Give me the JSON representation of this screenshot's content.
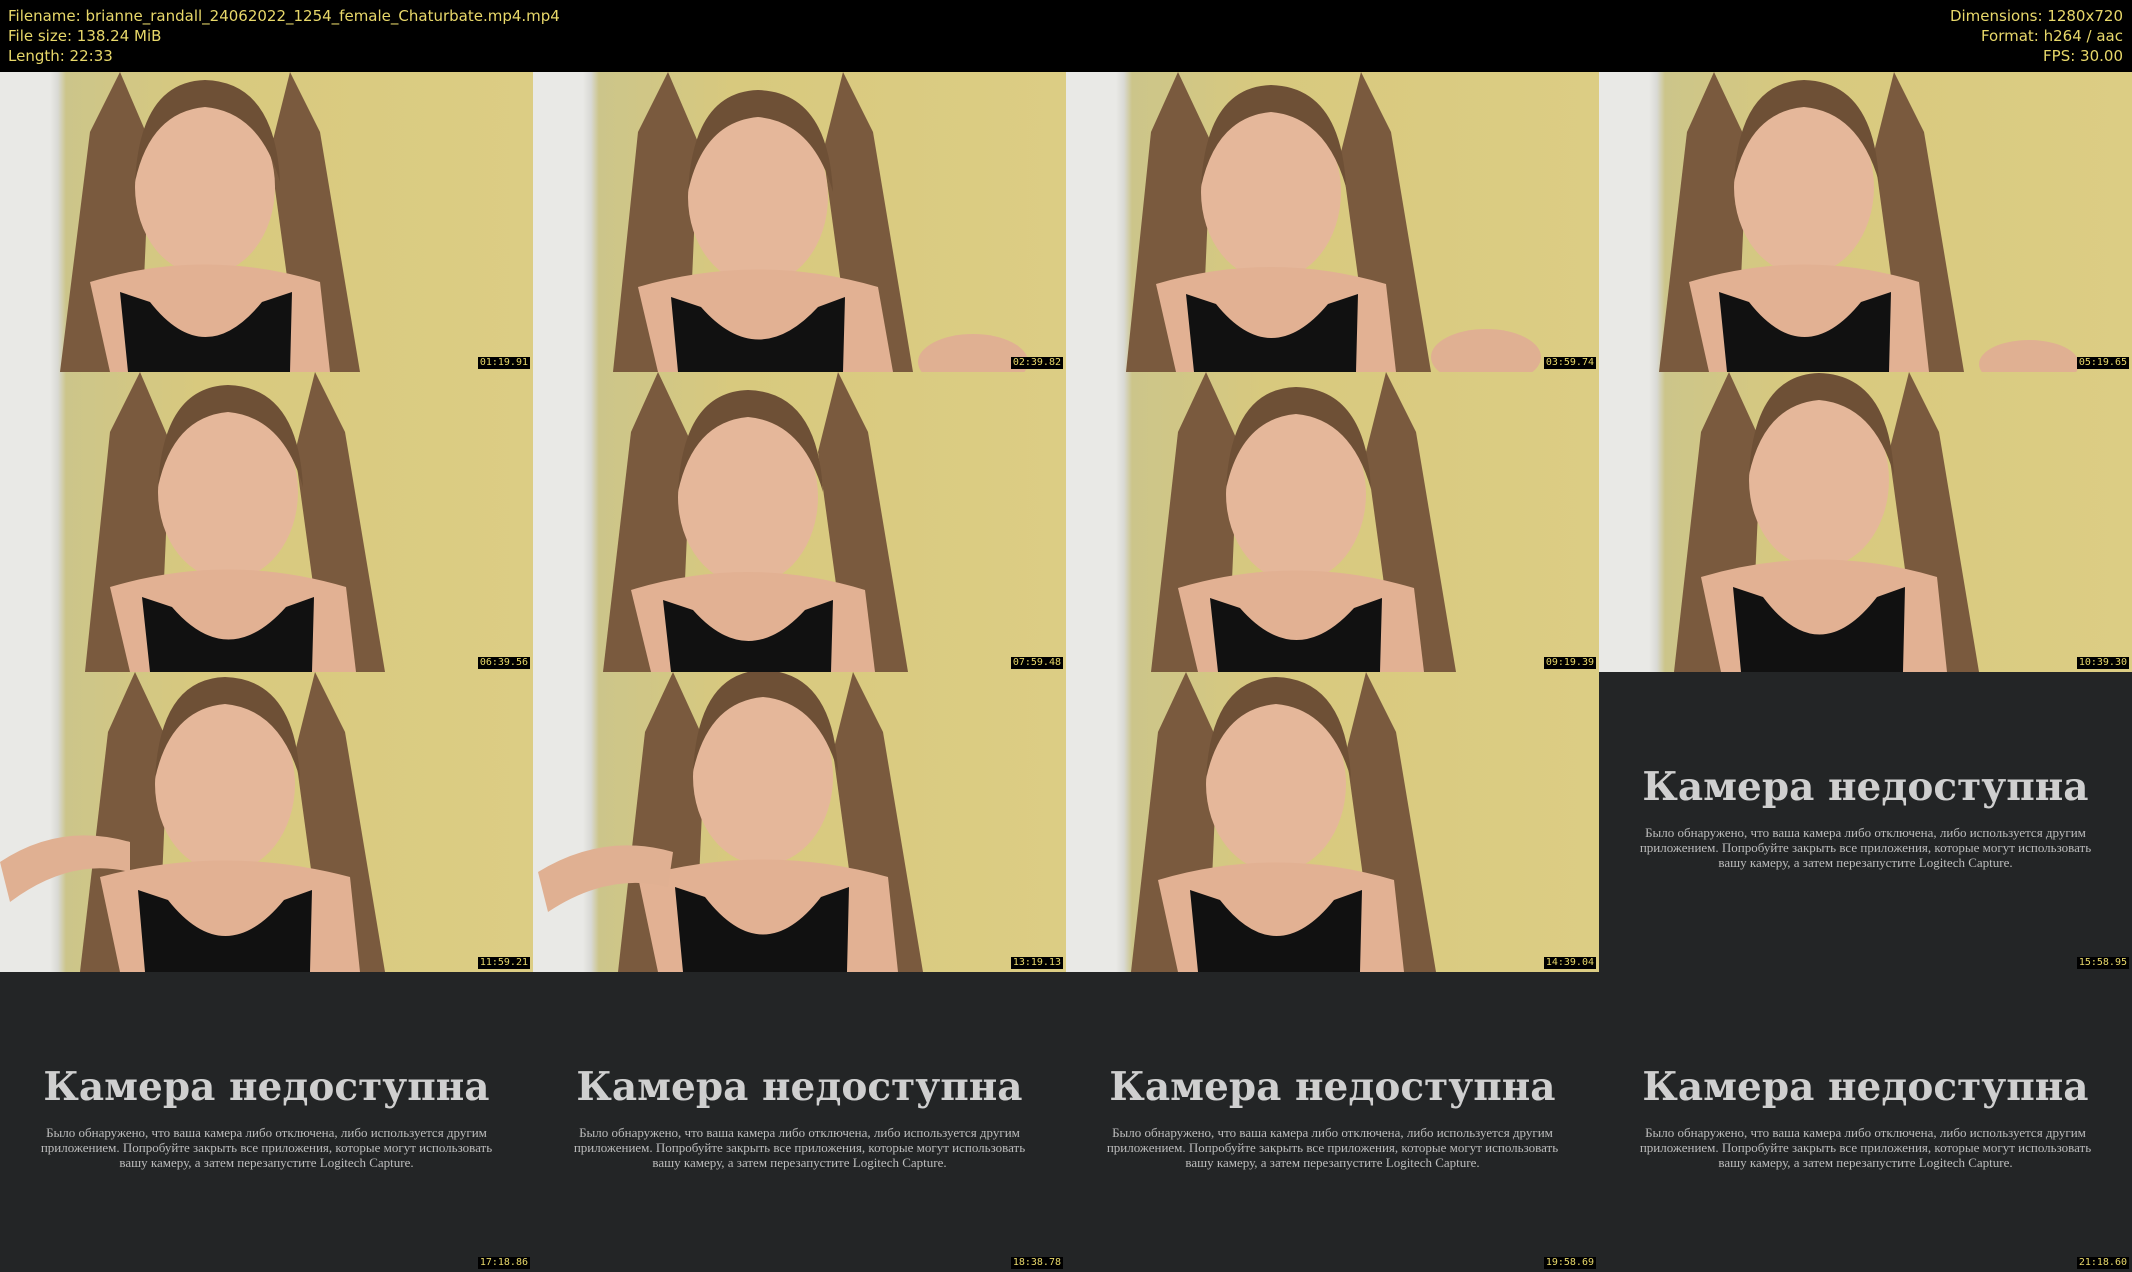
{
  "header": {
    "filename": "Filename: brianne_randall_24062022_1254_female_Chaturbate.mp4.mp4",
    "filesize": "File size: 138.24 MiB",
    "length": "Length: 22:33",
    "dimensions": "Dimensions: 1280x720",
    "format": "Format: h264 / aac",
    "fps": "FPS: 30.00"
  },
  "camera_unavailable": {
    "title": "Камера недоступна",
    "message": "Было обнаружено, что ваша камера либо отключена, либо используется другим приложением. Попробуйте закрыть все приложения, которые могут использовать вашу камеру, а затем перезапустите Logitech Capture."
  },
  "thumbnails": [
    {
      "time": "01:19.91"
    },
    {
      "time": "02:39.82"
    },
    {
      "time": "03:59.74"
    },
    {
      "time": "05:19.65"
    },
    {
      "time": "06:39.56"
    },
    {
      "time": "07:59.48"
    },
    {
      "time": "09:19.39"
    },
    {
      "time": "10:39.30"
    },
    {
      "time": "11:59.21"
    },
    {
      "time": "13:19.13"
    },
    {
      "time": "14:39.04"
    },
    {
      "time": "15:58.95"
    },
    {
      "time": "17:18.86"
    },
    {
      "time": "18:38.78"
    },
    {
      "time": "19:58.69"
    },
    {
      "time": "21:18.60"
    }
  ]
}
